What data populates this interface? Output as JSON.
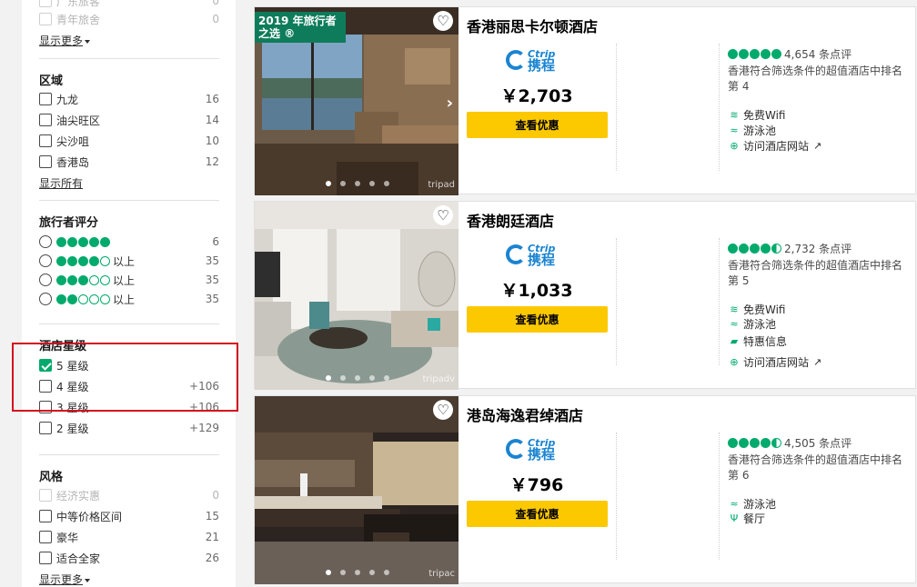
{
  "sidebar": {
    "top_rows": [
      {
        "label": "广东旅客",
        "count": "0"
      },
      {
        "label": "青年旅舍",
        "count": "0"
      }
    ],
    "show_more_1": "显示更多",
    "area": {
      "title": "区域",
      "items": [
        {
          "label": "九龙",
          "count": "16"
        },
        {
          "label": "油尖旺区",
          "count": "14"
        },
        {
          "label": "尖沙咀",
          "count": "10"
        },
        {
          "label": "香港岛",
          "count": "12"
        }
      ],
      "show_all": "显示所有"
    },
    "rating": {
      "title": "旅行者评分",
      "items": [
        {
          "bubbles": 5,
          "suffix": "",
          "count": "6"
        },
        {
          "bubbles": 4,
          "suffix": "以上",
          "count": "35"
        },
        {
          "bubbles": 3,
          "suffix": "以上",
          "count": "35"
        },
        {
          "bubbles": 2,
          "suffix": "以上",
          "count": "35"
        }
      ]
    },
    "stars": {
      "title": "酒店星级",
      "items": [
        {
          "label": "5 星级",
          "count": "",
          "checked": true
        },
        {
          "label": "4 星级",
          "count": "+106",
          "checked": false
        },
        {
          "label": "3 星级",
          "count": "+106",
          "checked": false
        },
        {
          "label": "2 星级",
          "count": "+129",
          "checked": false
        }
      ]
    },
    "style": {
      "title": "风格",
      "items": [
        {
          "label": "经济实惠",
          "count": "0"
        },
        {
          "label": "中等价格区间",
          "count": "15"
        },
        {
          "label": "豪华",
          "count": "21"
        },
        {
          "label": "适合全家",
          "count": "26"
        }
      ],
      "show_more": "显示更多"
    }
  },
  "hotels": [
    {
      "award": "2019 年旅行者之选",
      "award_mark": "®",
      "name": "香港丽思卡尔顿酒店",
      "provider_en": "Ctrip",
      "provider_zh": "携程",
      "price": "￥2,703",
      "deal_label": "查看优惠",
      "bubbles": 5,
      "reviews": "4,654 条点评",
      "rank": "香港符合筛选条件的超值酒店中排名第 4",
      "amenities": [
        {
          "icon": "wifi-icon",
          "label": "免费Wifi"
        },
        {
          "icon": "pool-icon",
          "label": "游泳池"
        },
        {
          "icon": "globe-icon",
          "label": "访问酒店网站"
        }
      ],
      "watermark": "tripad"
    },
    {
      "award": "",
      "award_mark": "",
      "name": "香港朗廷酒店",
      "provider_en": "Ctrip",
      "provider_zh": "携程",
      "price": "￥1,033",
      "deal_label": "查看优惠",
      "bubbles": 4.5,
      "reviews": "2,732 条点评",
      "rank": "香港符合筛选条件的超值酒店中排名第 5",
      "amenities": [
        {
          "icon": "wifi-icon",
          "label": "免费Wifi"
        },
        {
          "icon": "pool-icon",
          "label": "游泳池"
        },
        {
          "icon": "tag-icon",
          "label": "特惠信息"
        },
        {
          "icon": "globe-icon",
          "label": "访问酒店网站"
        }
      ],
      "watermark": "tripadv"
    },
    {
      "award": "",
      "award_mark": "",
      "name": "港岛海逸君绰酒店",
      "provider_en": "Ctrip",
      "provider_zh": "携程",
      "price": "￥796",
      "deal_label": "查看优惠",
      "bubbles": 4.5,
      "reviews": "4,505 条点评",
      "rank": "香港符合筛选条件的超值酒店中排名第 6",
      "amenities": [
        {
          "icon": "pool-icon",
          "label": "游泳池"
        },
        {
          "icon": "fork-knife-icon",
          "label": "餐厅"
        }
      ],
      "watermark": "tripac"
    }
  ],
  "colors": {
    "accent": "#00aa6c",
    "deal": "#fcc800",
    "highlight": "#d40c1e",
    "ctrip": "#1b84d1"
  }
}
